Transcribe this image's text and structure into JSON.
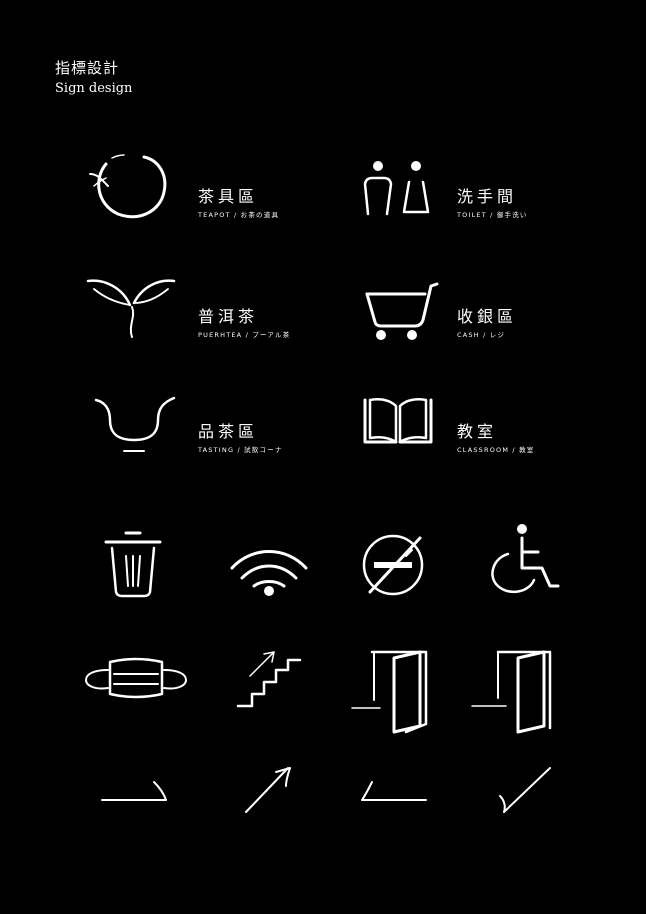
{
  "header": {
    "title_zh": "指標設計",
    "title_en": "Sign design"
  },
  "signs": [
    {
      "zh": "茶具區",
      "sub": "TEAPOT / お茶の道具",
      "icon": "teapot-icon"
    },
    {
      "zh": "洗手間",
      "sub": "TOILET / 御手洗い",
      "icon": "toilet-icon"
    },
    {
      "zh": "普洱茶",
      "sub": "PUERHTEA / プーアル茶",
      "icon": "tea-leaf-icon"
    },
    {
      "zh": "收銀區",
      "sub": "CASH / レジ",
      "icon": "cart-icon"
    },
    {
      "zh": "品茶區",
      "sub": "TASTING / 試飲コーナ",
      "icon": "tasting-cup-icon"
    },
    {
      "zh": "教室",
      "sub": "CLASSROOM / 教室",
      "icon": "book-icon"
    }
  ],
  "icons": [
    "trash-icon",
    "wifi-icon",
    "no-smoking-icon",
    "wheelchair-icon",
    "mask-icon",
    "stairs-icon",
    "door-exit-left-icon",
    "door-exit-right-icon",
    "stroke-horizontal-icon",
    "stroke-diagonal-icon",
    "stroke-corner-icon",
    "stroke-check-icon"
  ]
}
